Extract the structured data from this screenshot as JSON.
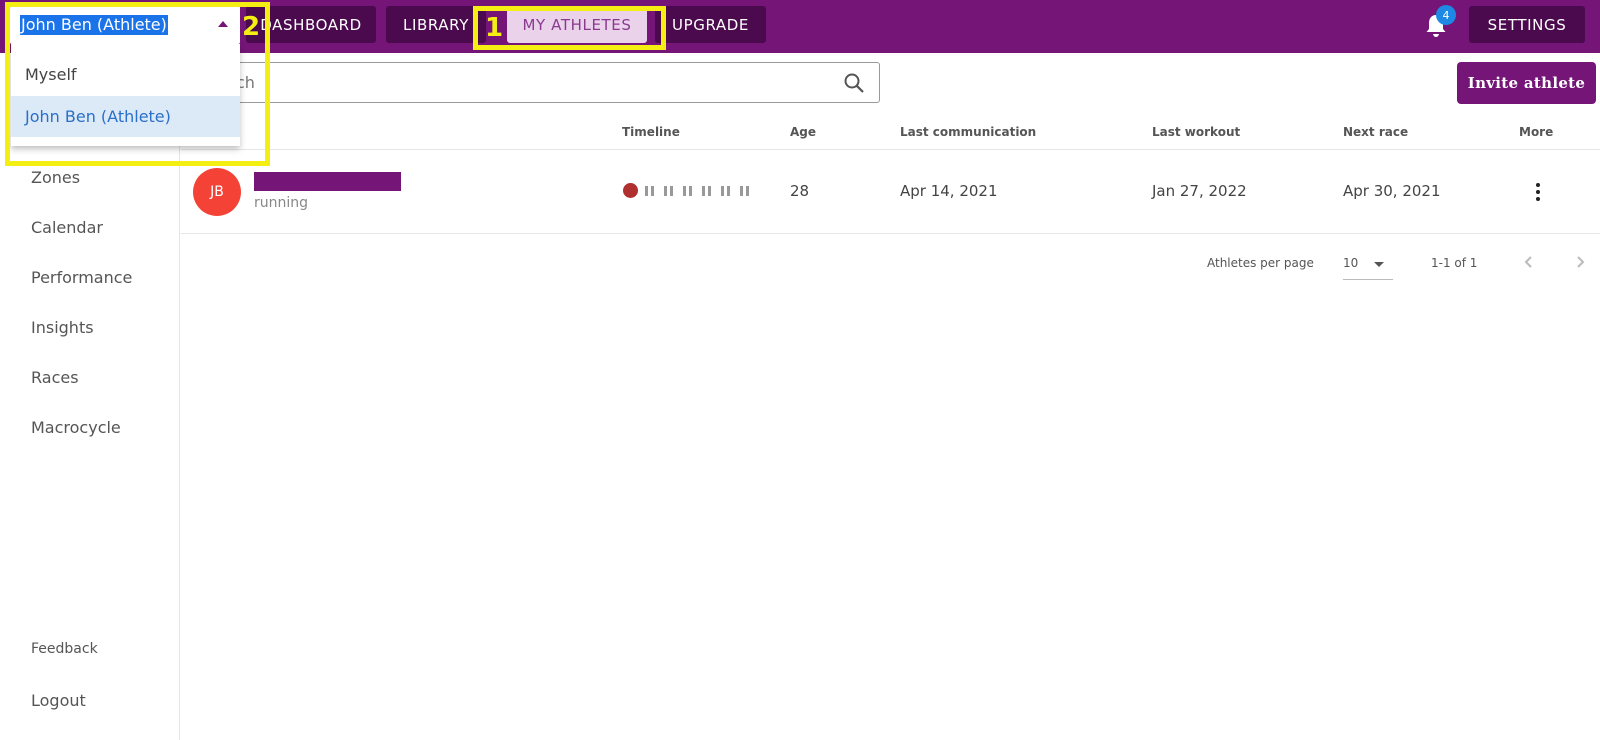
{
  "topbar": {
    "nav": [
      {
        "label": "DASHBOARD"
      },
      {
        "label": "LIBRARY"
      },
      {
        "label": "MY ATHLETES"
      },
      {
        "label": "UPGRADE"
      }
    ],
    "notifications_count": "4",
    "settings_label": "SETTINGS",
    "brand_color": "#741577"
  },
  "athlete_select": {
    "value": "John  Ben (Athlete)",
    "options": [
      {
        "label": "Myself"
      },
      {
        "label": "John Ben (Athlete)"
      }
    ]
  },
  "annotations": {
    "box1": "1",
    "box2": "2"
  },
  "sidebar": {
    "items": [
      {
        "label": "Zones"
      },
      {
        "label": "Calendar"
      },
      {
        "label": "Performance"
      },
      {
        "label": "Insights"
      },
      {
        "label": "Races"
      },
      {
        "label": "Macrocycle"
      }
    ],
    "footer": [
      {
        "label": "Feedback"
      },
      {
        "label": "Logout"
      }
    ]
  },
  "search": {
    "placeholder": "ch"
  },
  "invite_label": "Invite athlete",
  "table": {
    "headers": {
      "timeline": "Timeline",
      "age": "Age",
      "last_communication": "Last communication",
      "last_workout": "Last workout",
      "next_race": "Next race",
      "more": "More"
    },
    "rows": [
      {
        "initials": "JB",
        "sport": "running",
        "age": "28",
        "last_communication": "Apr 14, 2021",
        "last_workout": "Jan 27, 2022",
        "next_race": "Apr 30, 2021"
      }
    ]
  },
  "pagination": {
    "per_page_label": "Athletes per page",
    "per_page_value": "10",
    "range": "1-1 of 1"
  }
}
